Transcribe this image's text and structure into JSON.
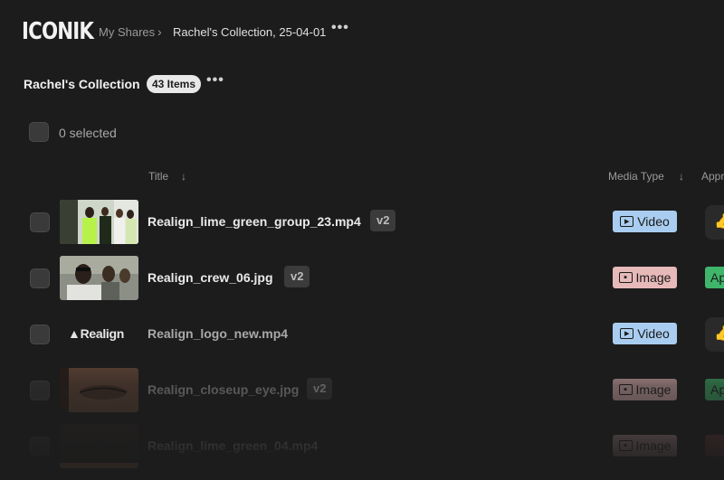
{
  "header": {
    "logo": "ICONIK",
    "breadcrumb": {
      "parent": "My Shares",
      "separator": "›",
      "current": "Rachel's Collection, 25-04-01",
      "more": "•••"
    }
  },
  "collection": {
    "title": "Rachel's Collection",
    "count": "43 Items",
    "more": "•••"
  },
  "selection": {
    "text": "0 selected"
  },
  "columns": {
    "title": "Title",
    "media_type": "Media Type",
    "approval": "Appr",
    "sort_arrow": "↓"
  },
  "rows": [
    {
      "filename": "Realign_lime_green_group_23.mp4",
      "version": "v2",
      "media_type": "Video",
      "approval": "",
      "thumb": "group-photo"
    },
    {
      "filename": "Realign_crew_06.jpg",
      "version": "v2",
      "media_type": "Image",
      "approval": "Ap",
      "thumb": "crew-photo"
    },
    {
      "filename": "Realign_logo_new.mp4",
      "version": "",
      "media_type": "Video",
      "approval": "",
      "thumb": "logo",
      "logo_text": "Realign"
    },
    {
      "filename": "Realign_closeup_eye.jpg",
      "version": "v2",
      "media_type": "Image",
      "approval": "Ap",
      "thumb": "eye-closeup"
    },
    {
      "filename": "Realign_lime_green_04.mp4",
      "version": "",
      "media_type": "Image",
      "approval": "",
      "thumb": "dark"
    }
  ],
  "colors": {
    "background": "#1c1c1c",
    "video_badge": "#a9cdf0",
    "image_badge": "#e7b9b9",
    "approved": "#3fb66a"
  }
}
